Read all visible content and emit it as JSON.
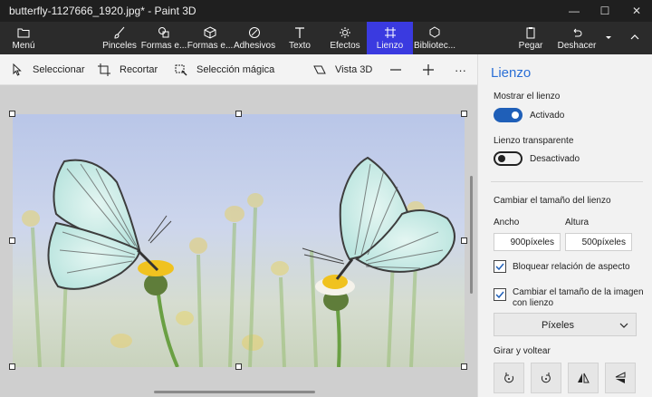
{
  "window": {
    "title": "butterfly-1127666_1920.jpg* - Paint 3D",
    "controls": {
      "minimize": "—",
      "maximize": "☐",
      "close": "✕"
    }
  },
  "ribbon": {
    "menu": {
      "label": "Menú",
      "icon": "folder-icon"
    },
    "tabs": [
      {
        "label": "Pinceles",
        "icon": "brush-icon"
      },
      {
        "label": "Formas e...",
        "icon": "2d-shapes-icon"
      },
      {
        "label": "Formas e...",
        "icon": "3d-shapes-icon"
      },
      {
        "label": "Adhesivos",
        "icon": "sticker-icon"
      },
      {
        "label": "Texto",
        "icon": "text-icon"
      },
      {
        "label": "Efectos",
        "icon": "effects-icon"
      },
      {
        "label": "Lienzo",
        "icon": "canvas-icon",
        "active": true
      },
      {
        "label": "Bibliotec...",
        "icon": "library-icon"
      }
    ],
    "paste": "Pegar",
    "undo": "Deshacer"
  },
  "toolbar": {
    "select": "Seleccionar",
    "crop": "Recortar",
    "magic_select": "Selección mágica",
    "view_3d": "Vista 3D",
    "more": "···"
  },
  "panel": {
    "title": "Lienzo",
    "show_canvas": {
      "label": "Mostrar el lienzo",
      "state": "Activado"
    },
    "transparent_canvas": {
      "label": "Lienzo transparente",
      "state": "Desactivado"
    },
    "resize_heading": "Cambiar el tamaño del lienzo",
    "width_label": "Ancho",
    "height_label": "Altura",
    "width_value": "900píxeles",
    "height_value": "500píxeles",
    "lock_aspect": "Bloquear relación de aspecto",
    "resize_image_line1": "Cambiar el tamaño de la imagen",
    "resize_image_line2": "con lienzo",
    "unit_select": "Píxeles",
    "rotate_heading": "Girar y voltear"
  },
  "colors": {
    "accent": "#3a3ae0",
    "panel_title": "#2b6fd6",
    "toggle_on": "#1f5fb8"
  }
}
